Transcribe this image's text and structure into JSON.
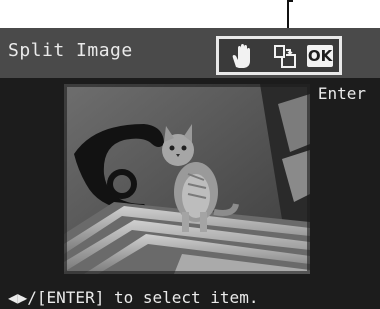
{
  "header": {
    "title": "Split Image"
  },
  "toolbar": {
    "hand_icon": "hand-icon",
    "rotate_icon": "rotate-icon",
    "ok_label": "OK"
  },
  "enter_label": "Enter",
  "hint": "◀▶/[ENTER] to select item.",
  "colors": {
    "screen_bg": "#1c1c1c",
    "title_bar_bg": "#4a4a4a",
    "text": "#eaeaea",
    "highlight_border": "#e9e9e9"
  }
}
